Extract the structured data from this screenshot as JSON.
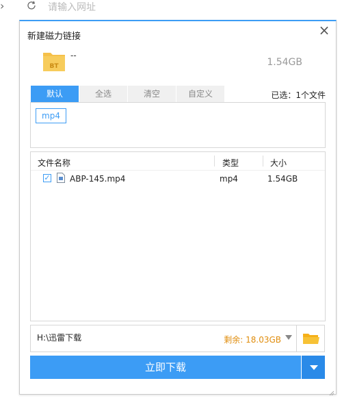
{
  "browser": {
    "address_placeholder": "请输入网址",
    "forward_icon": "chevron-right-icon",
    "reload_icon": "reload-icon"
  },
  "dialog": {
    "title": "新建磁力链接",
    "close_icon": "close-icon",
    "task": {
      "icon": "bt-file-icon",
      "icon_badge": "BT",
      "name": "--",
      "size": "1.54GB"
    },
    "tabs": [
      {
        "label": "默认",
        "active": true
      },
      {
        "label": "全选",
        "active": false
      },
      {
        "label": "清空",
        "active": false
      },
      {
        "label": "自定义",
        "active": false
      }
    ],
    "selected_summary": "已选：1个文件",
    "extension_tags": [
      "mp4"
    ],
    "file_list": {
      "columns": [
        "文件名称",
        "类型",
        "大小"
      ],
      "rows": [
        {
          "checked": true,
          "name": "ABP-145.mp4",
          "type": "mp4",
          "size": "1.54GB"
        }
      ]
    },
    "save_path": "H:\\迅雷下载",
    "free_space": "剩余: 18.03GB",
    "download_label": "立即下载"
  },
  "colors": {
    "accent": "#3c9cf5",
    "free_space": "#e08d0d",
    "folder": "#f5b019"
  }
}
